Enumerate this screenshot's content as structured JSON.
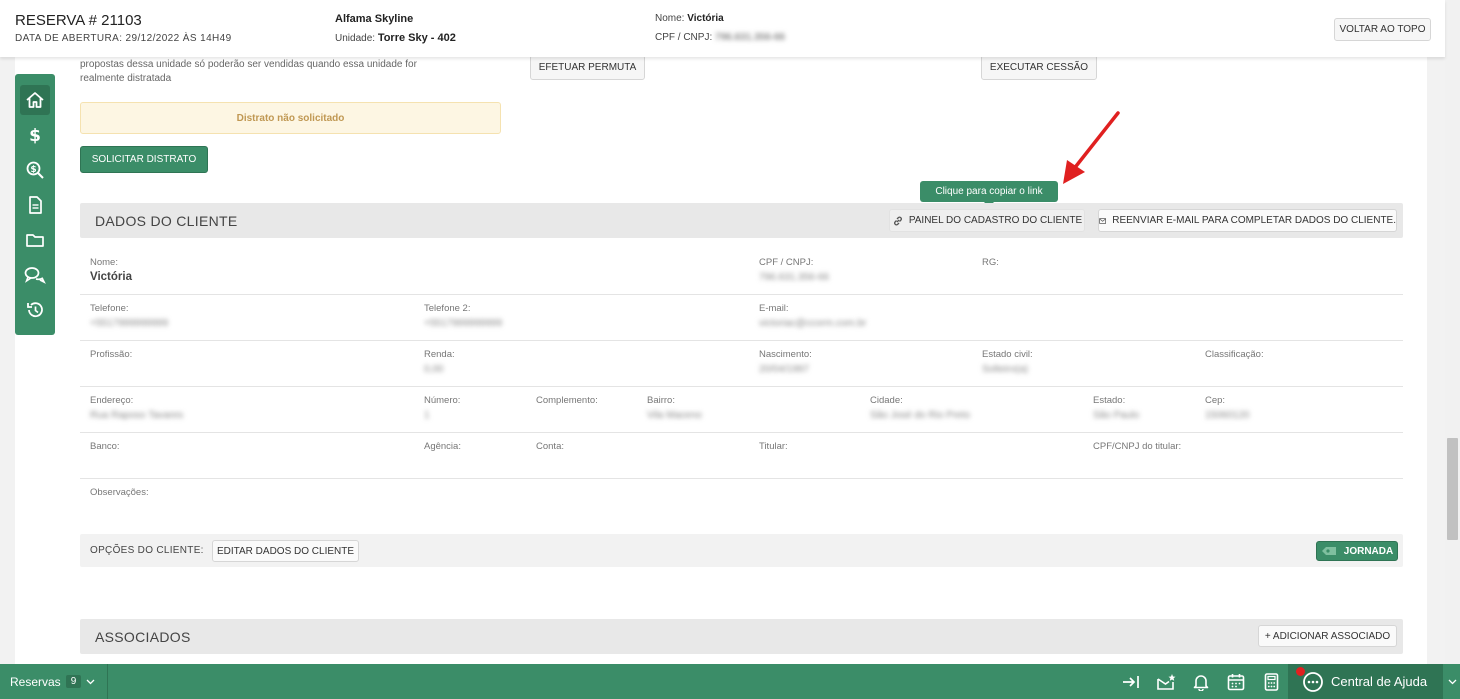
{
  "header": {
    "reservation_title": "RESERVA # 21103",
    "opening_date": "DATA DE ABERTURA: 29/12/2022 ÀS 14H49",
    "project_name": "Alfama Skyline",
    "unit_label": "Unidade:",
    "unit_value": "Torre Sky - 402",
    "name_label": "Nome:",
    "name_value": "Victória",
    "doc_label": "CPF / CNPJ:",
    "doc_value": "796.631.356-66",
    "back_to_top": "VOLTAR AO TOPO"
  },
  "top_section": {
    "notice_line1": "propostas dessa unidade só poderão ser vendidas quando essa unidade for",
    "notice_line2": "realmente distratada",
    "permuta_button": "EFETUAR PERMUTA",
    "cessao_button": "EXECUTAR CESSÃO",
    "distrato_status": "Distrato não solicitado",
    "request_distrato_button": "SOLICITAR DISTRATO"
  },
  "tooltip": "Clique para copiar o link",
  "client_section": {
    "title": "DADOS DO CLIENTE",
    "panel_button": "PAINEL DO CADASTRO DO CLIENTE",
    "resend_button": "REENVIAR E-MAIL PARA COMPLETAR DADOS DO CLIENTE.",
    "fields": {
      "nome_label": "Nome:",
      "nome_value": "Victória",
      "cpf_label": "CPF / CNPJ:",
      "cpf_value": "796.631.356-66",
      "rg_label": "RG:",
      "telefone_label": "Telefone:",
      "telefone_value": "+5517999999999",
      "telefone2_label": "Telefone 2:",
      "telefone2_value": "+5517999999999",
      "email_label": "E-mail:",
      "email_value": "victoriac@ccorm.com.br",
      "profissao_label": "Profissão:",
      "renda_label": "Renda:",
      "renda_value": "0,00",
      "nascimento_label": "Nascimento:",
      "nascimento_value": "20/04/1997",
      "estado_civil_label": "Estado civil:",
      "estado_civil_value": "Solteiro(a)",
      "classificacao_label": "Classificação:",
      "endereco_label": "Endereço:",
      "endereco_value": "Rua Raposo Tavares",
      "numero_label": "Número:",
      "numero_value": "1",
      "complemento_label": "Complemento:",
      "bairro_label": "Bairro:",
      "bairro_value": "Vila Maceno",
      "cidade_label": "Cidade:",
      "cidade_value": "São José do Rio Preto",
      "estado_label": "Estado:",
      "estado_value": "São Paulo",
      "cep_label": "Cep:",
      "cep_value": "15060120",
      "banco_label": "Banco:",
      "agencia_label": "Agência:",
      "conta_label": "Conta:",
      "titular_label": "Titular:",
      "cpf_titular_label": "CPF/CNPJ do titular:",
      "observacoes_label": "Observações:"
    },
    "options_label": "OPÇÕES DO CLIENTE:",
    "edit_button": "EDITAR DADOS DO CLIENTE",
    "journey_button": "JORNADA"
  },
  "associates_section": {
    "title": "ASSOCIADOS",
    "add_button": "+ ADICIONAR ASSOCIADO"
  },
  "bottom_bar": {
    "reservas_label": "Reservas",
    "reservas_count": "9",
    "help_label": "Central de Ajuda"
  },
  "colors": {
    "brand_green": "#3b8d68",
    "alert_bg": "#fdf6e3",
    "alert_text": "#c09853",
    "arrow_red": "#e02020"
  },
  "icons": {
    "sidebar": [
      "home-icon",
      "dollar-icon",
      "search-dollar-icon",
      "document-icon",
      "folder-icon",
      "chat-icon",
      "history-icon"
    ],
    "bottom": [
      "collapse-right-icon",
      "mail-star-icon",
      "bell-icon",
      "calendar-icon",
      "calculator-icon",
      "chat-help-icon"
    ]
  }
}
